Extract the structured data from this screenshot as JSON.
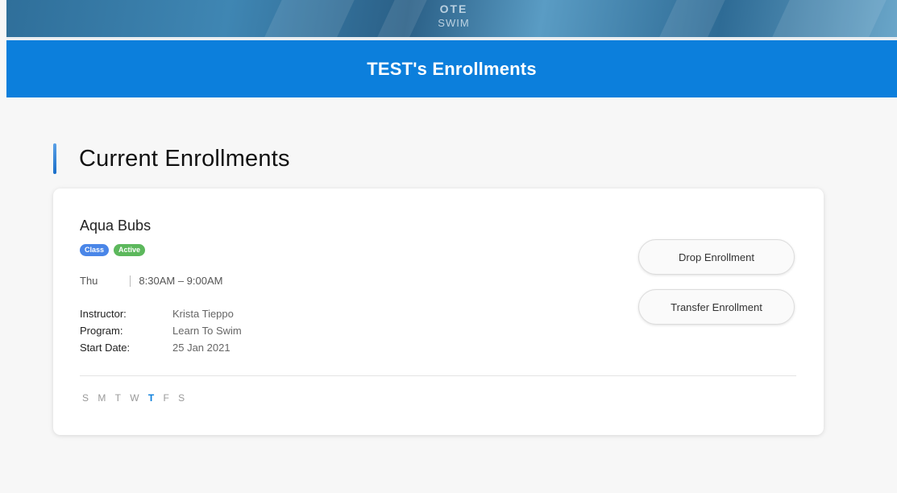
{
  "hero": {
    "logo_top": "OTE",
    "logo_bottom": "SWIM"
  },
  "header": {
    "title": "TEST's Enrollments"
  },
  "section": {
    "title": "Current Enrollments"
  },
  "enrollment": {
    "name": "Aqua Bubs",
    "badges": {
      "class": "Class",
      "status": "Active"
    },
    "day": "Thu",
    "time": "8:30AM – 9:00AM",
    "details": [
      {
        "label": "Instructor:",
        "value": "Krista Tieppo"
      },
      {
        "label": "Program:",
        "value": "Learn To Swim"
      },
      {
        "label": "Start Date:",
        "value": "25 Jan 2021"
      }
    ],
    "weekdays": [
      "S",
      "M",
      "T",
      "W",
      "T",
      "F",
      "S"
    ],
    "active_weekday_index": 4,
    "actions": {
      "drop": "Drop Enrollment",
      "transfer": "Transfer Enrollment"
    }
  },
  "colors": {
    "brand_blue": "#0c7fdc",
    "badge_class": "#4a86e8",
    "badge_active": "#5cb85c"
  }
}
